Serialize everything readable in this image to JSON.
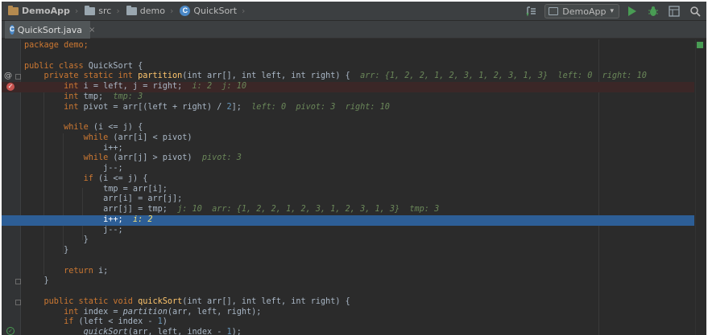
{
  "navbar": {
    "project": "DemoApp",
    "folder1": "src",
    "folder2": "demo",
    "file": "QuickSort",
    "class_icon_letter": "C",
    "run_config": "DemoApp"
  },
  "tabs": [
    {
      "label": "QuickSort.java",
      "close": "×"
    }
  ],
  "colors": {
    "keyword": "#cc7832",
    "function": "#ffc66d",
    "debug_value": "#6a8759",
    "current_line": "#2d5e96",
    "error_line": "#3b2727",
    "run": "#499c54"
  },
  "code": {
    "l1": "package demo;",
    "l3a": "public class",
    "l3b": " QuickSort {",
    "l4a": "    private static int ",
    "l4b": "partition",
    "l4c": "(int arr[], int left, int right) {",
    "l4d": "  arr: {1, 2, 2, 1, 2, 3, 1, 2, 3, 1, 3}  left: 0  right: 10",
    "l5a": "        int",
    "l5b": " i = left, j = right;",
    "l5c": "  i: 2  j: 10",
    "l6a": "        int",
    "l6b": " tmp;",
    "l6c": "  tmp: 3",
    "l7a": "        int",
    "l7b": " pivot = arr[(left + right) / ",
    "l7n": "2",
    "l7e": "];",
    "l7c": "  left: 0  pivot: 3  right: 10",
    "l9a": "        while",
    "l9b": " (i <= j) {",
    "l10a": "            while",
    "l10b": " (arr[i] < pivot)",
    "l11": "                i++;",
    "l12a": "            while",
    "l12b": " (arr[j] > pivot)",
    "l12c": "  pivot: 3",
    "l13": "                j--;",
    "l14a": "            if",
    "l14b": " (i <= j) {",
    "l15": "                tmp = arr[i];",
    "l16": "                arr[i] = arr[j];",
    "l17": "                arr[j] = tmp;",
    "l17c": "  j: 10  arr: {1, 2, 2, 1, 2, 3, 1, 2, 3, 1, 3}  tmp: 3",
    "l18": "                i++;",
    "l18c": "  i: 2",
    "l19": "                j--;",
    "l20": "            }",
    "l21": "        }",
    "l23a": "        return",
    "l23b": " i;",
    "l24": "    }",
    "l26a": "    public static void ",
    "l26b": "quickSort",
    "l26c": "(int arr[], int left, int right) {",
    "l27a": "        int",
    "l27b": " index = ",
    "l27c": "partition",
    "l27d": "(arr, left, right);",
    "l28a": "        if",
    "l28b": " (left < index - ",
    "l28n": "1",
    "l28e": ")",
    "l29a": "            ",
    "l29b": "quickSort",
    "l29c": "(arr, left, index - ",
    "l29n": "1",
    "l29e": ");"
  }
}
